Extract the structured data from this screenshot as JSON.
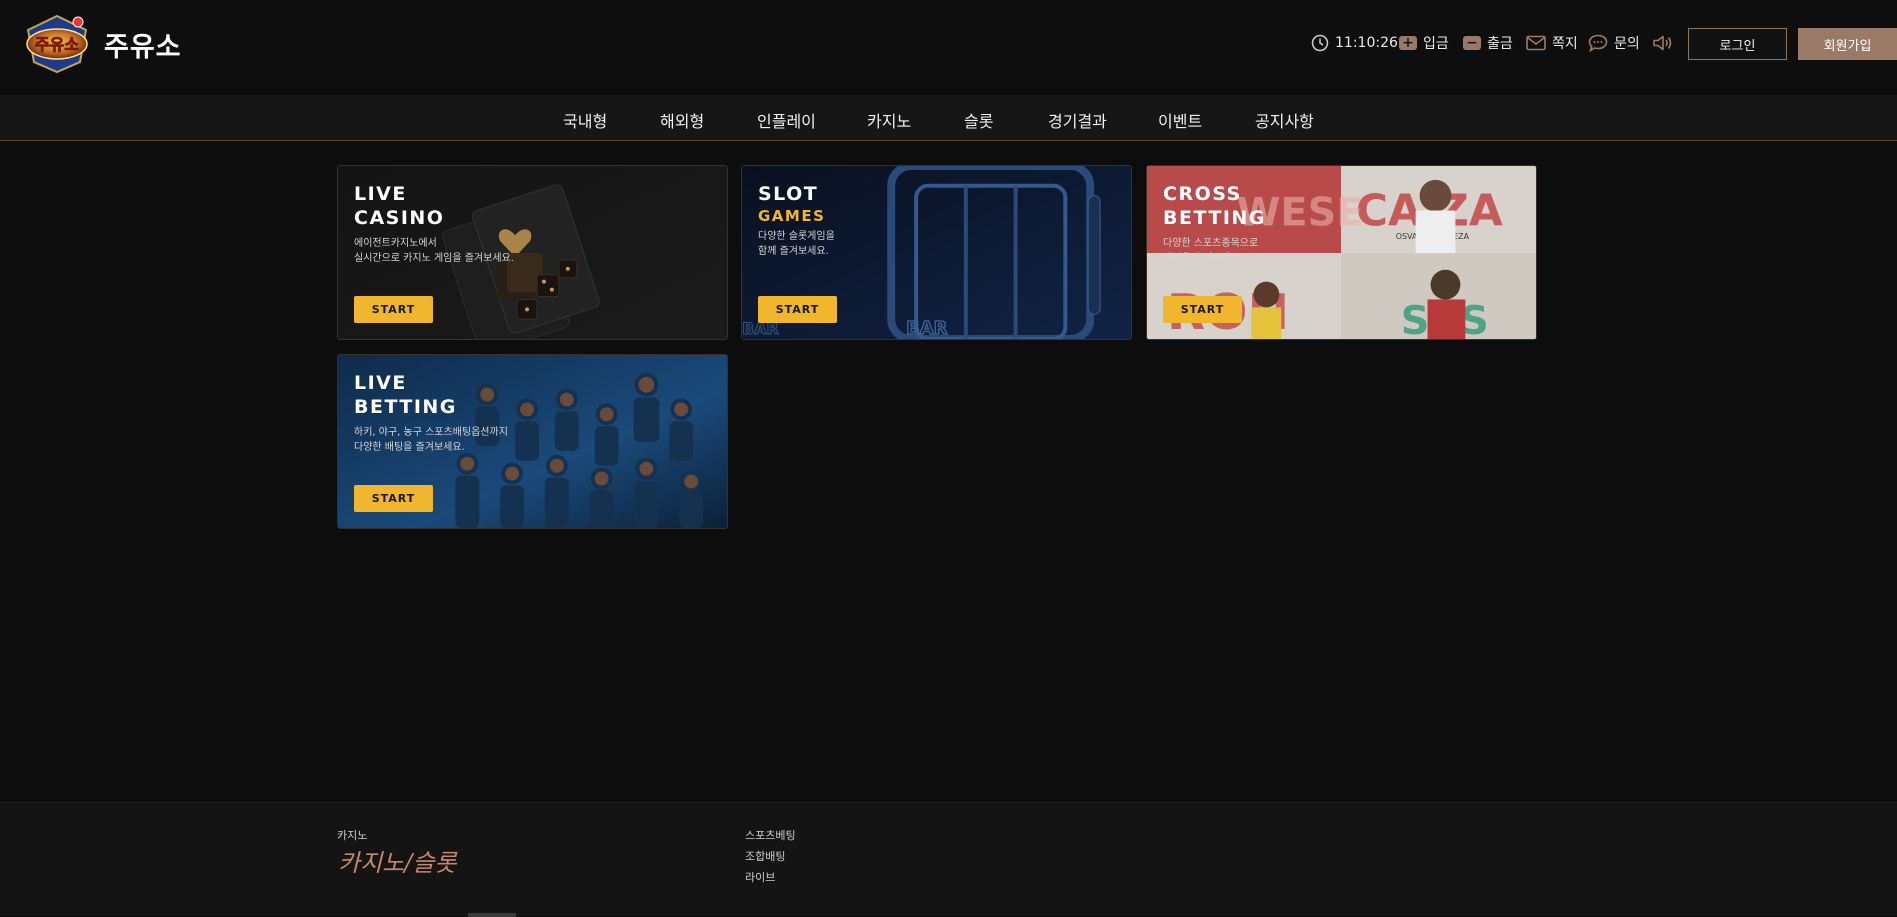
{
  "header": {
    "site_name": "주유소",
    "clock": "11:10:26",
    "deposit_label": "입금",
    "withdraw_label": "출금",
    "message_label": "쪽지",
    "inquiry_label": "문의",
    "login_label": "로그인",
    "join_label": "회원가입"
  },
  "nav": {
    "items": [
      "국내형",
      "해외형",
      "인플레이",
      "카지노",
      "슬롯",
      "경기결과",
      "이벤트",
      "공지사항"
    ]
  },
  "cards": [
    {
      "title1": "LIVE",
      "title2": "CASINO",
      "desc": "에이전트카지노에서\n실시간으로 카지노 게임을 즐겨보세요.",
      "button": "START"
    },
    {
      "title1": "SLOT",
      "accent": "GAMES",
      "desc": "다양한 슬롯게임을\n함께 즐겨보세요.",
      "button": "START"
    },
    {
      "title1": "CROSS",
      "title2": "BETTING",
      "desc": "다양한 스포츠종목으로\n배팅을 즐겨보세요.",
      "button": "START"
    },
    {
      "title1": "LIVE",
      "title2": "BETTING",
      "desc": "하키, 야구, 농구 스포츠배팅옵션까지\n다양한 배팅을 즐겨보세요.",
      "button": "START"
    }
  ],
  "footer": {
    "col1_title": "카지노",
    "col1_script": "카지노/슬롯",
    "links": [
      "스포츠베팅",
      "조합배팅",
      "라이브"
    ]
  },
  "colors": {
    "accent_gold": "#f0b62e",
    "brand_brown": "#9a7a66"
  }
}
